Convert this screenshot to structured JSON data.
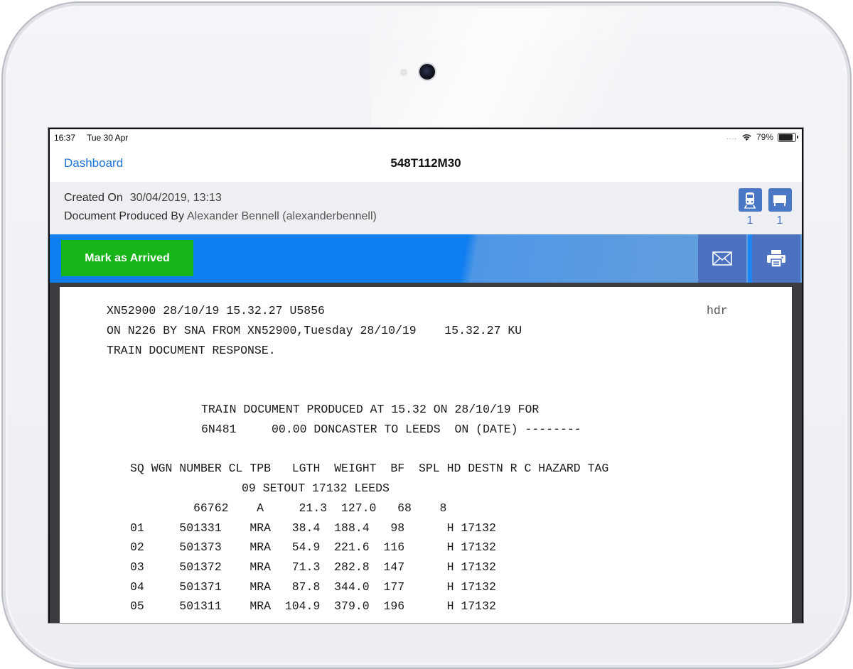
{
  "status_bar": {
    "time": "16:37",
    "date": "Tue 30 Apr",
    "signal": "....",
    "battery": "79%"
  },
  "nav": {
    "back_label": "Dashboard",
    "title": "548T112M30"
  },
  "info": {
    "created_label": "Created On",
    "created_value": "30/04/2019, 13:13",
    "produced_label": "Document Produced By",
    "produced_value": "Alexander Bennell (alexanderbennell)",
    "counters": [
      {
        "icon": "locomotive-icon",
        "count": "1"
      },
      {
        "icon": "wagon-icon",
        "count": "1"
      }
    ]
  },
  "actions": {
    "arrive_label": "Mark as Arrived",
    "email_icon": "email-icon",
    "print_icon": "print-icon"
  },
  "document": {
    "header_line1": "XN52900 28/10/19 15.32.27 U5856",
    "header_tag": "hdr",
    "header_line2": "ON N226 BY SNA FROM XN52900,Tuesday 28/10/19    15.32.27 KU",
    "header_line3": "TRAIN DOCUMENT RESPONSE.",
    "produced_line": "TRAIN DOCUMENT PRODUCED AT 15.32 ON 28/10/19 FOR",
    "route_line": "6N481     00.00 DONCASTER TO LEEDS  ON (DATE) --------",
    "columns_line": "SQ WGN NUMBER CL TPB   LGTH  WEIGHT  BF  SPL HD DESTN R C HAZARD TAG",
    "setout_line": "09 SETOUT 17132 LEEDS",
    "loco_line": "66762    A     21.3  127.0   68    8",
    "rows": [
      "01     501331    MRA   38.4  188.4   98      H 17132",
      "02     501373    MRA   54.9  221.6  116      H 17132",
      "03     501372    MRA   71.3  282.8  147      H 17132",
      "04     501371    MRA   87.8  344.0  177      H 17132",
      "05     501311    MRA  104.9  379.0  196      H 17132"
    ]
  }
}
